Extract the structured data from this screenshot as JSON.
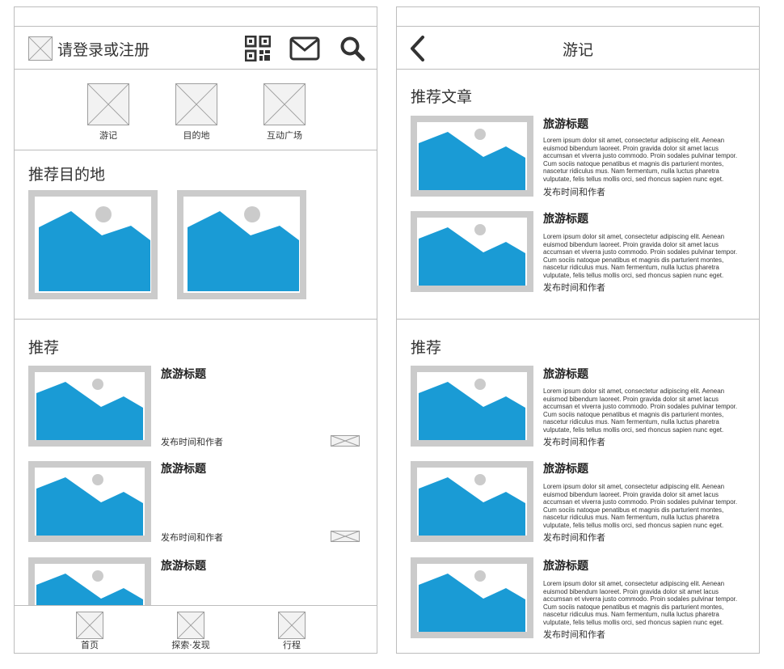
{
  "home": {
    "header": {
      "login_text": "请登录或注册",
      "icons": [
        "qr-code-icon",
        "mail-icon",
        "search-icon"
      ]
    },
    "categories": [
      {
        "label": "游记"
      },
      {
        "label": "目的地"
      },
      {
        "label": "互动广场"
      }
    ],
    "recommended_destinations": {
      "title": "推荐目的地"
    },
    "recommended": {
      "title": "推荐",
      "items": [
        {
          "title": "旅游标题",
          "meta": "发布时间和作者"
        },
        {
          "title": "旅游标题",
          "meta": "发布时间和作者"
        },
        {
          "title": "旅游标题",
          "meta": ""
        }
      ]
    },
    "tabbar": [
      {
        "label": "首页"
      },
      {
        "label": "探索·发现"
      },
      {
        "label": "行程"
      }
    ]
  },
  "travelogue": {
    "header": {
      "title": "游记"
    },
    "featured": {
      "title": "推荐文章",
      "items": [
        {
          "title": "旅游标题",
          "meta": "发布时间和作者"
        },
        {
          "title": "旅游标题",
          "meta": "发布时间和作者"
        }
      ]
    },
    "recommended": {
      "title": "推荐",
      "items": [
        {
          "title": "旅游标题",
          "meta": "发布时间和作者"
        },
        {
          "title": "旅游标题",
          "meta": "发布时间和作者"
        },
        {
          "title": "旅游标题",
          "meta": "发布时间和作者"
        }
      ]
    },
    "lorem": "Lorem ipsum dolor sit amet, consectetur adipiscing elit. Aenean euismod bibendum laoreet. Proin gravida dolor sit amet lacus accumsan et viverra justo commodo. Proin sodales pulvinar tempor. Cum sociis natoque penatibus et magnis dis parturient montes, nascetur ridiculus mus. Nam fermentum, nulla luctus pharetra vulputate, felis tellus mollis orci, sed rhoncus sapien nunc eget."
  },
  "colors": {
    "image_blue": "#1a9bd5",
    "image_frame": "#cbcbcb",
    "border": "#bdbdbd"
  }
}
